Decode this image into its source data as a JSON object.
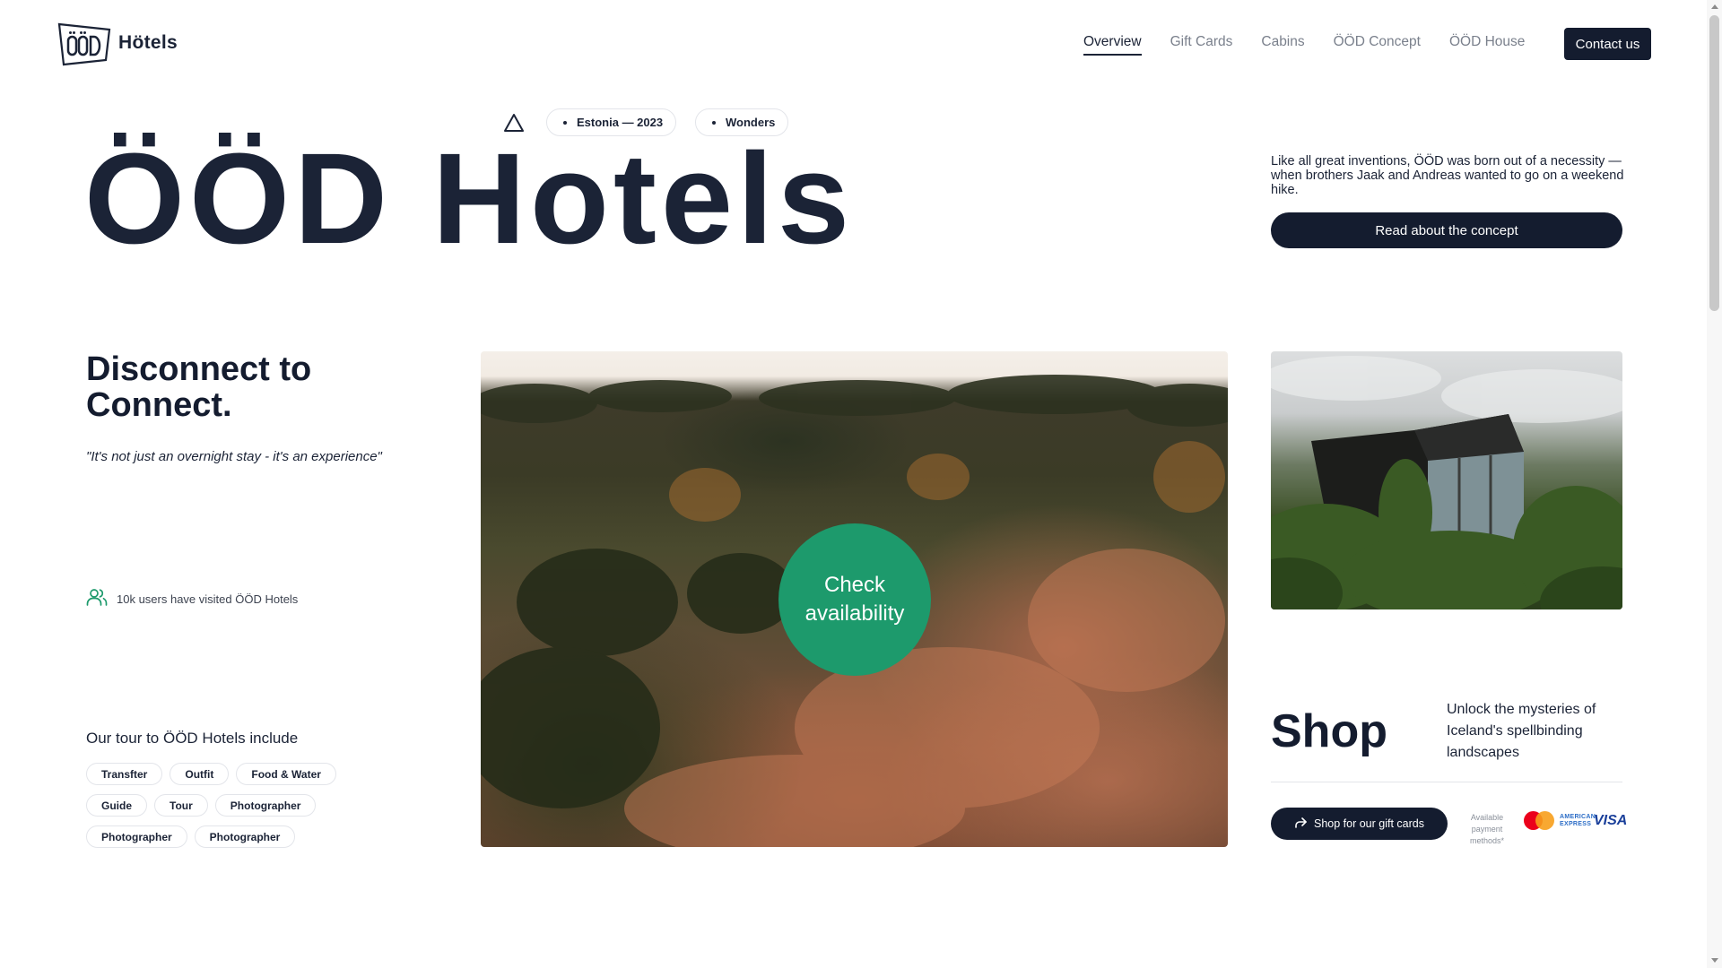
{
  "header": {
    "logo_text": "Hötels",
    "nav": [
      {
        "label": "Overview",
        "active": true
      },
      {
        "label": "Gift Cards",
        "active": false
      },
      {
        "label": "Cabins",
        "active": false
      },
      {
        "label": "ÖÖD Concept",
        "active": false
      },
      {
        "label": "ÖÖD House",
        "active": false
      }
    ],
    "contact_label": "Contact us"
  },
  "hero": {
    "icon": "triangle-icon",
    "tags": [
      "Estonia — 2023",
      "Wonders"
    ],
    "title": "ÖÖD Hotels",
    "description": "Like all great inventions, ÖÖD was born out of a necessity — when brothers Jaak and Andreas wanted to go on a weekend hike.",
    "concept_button": "Read about the concept"
  },
  "intro": {
    "heading": "Disconnect to Connect.",
    "quote": "\"It's not just an overnight stay - it's an experience\"",
    "visitors_text": "10k users have visited ÖÖD Hotels"
  },
  "tour": {
    "title": "Our tour to ÖÖD Hotels include",
    "items": [
      "Transfter",
      "Outfit",
      "Food & Water",
      "Guide",
      "Tour",
      "Photographer",
      "Photographer",
      "Photographer"
    ]
  },
  "main_photo": {
    "check_button": "Check availability"
  },
  "shop": {
    "title": "Shop",
    "description": "Unlock the mysteries of Iceland's spellbinding landscapes",
    "button": "Shop for our gift cards",
    "payment_label": "Available payment methods*",
    "payment_methods": [
      "mastercard-icon",
      "amex-icon",
      "visa-icon"
    ],
    "amex_text": "AMERICAN EXPRESS",
    "visa_text": "VISA"
  },
  "colors": {
    "primary_dark": "#141c2f",
    "accent_green": "#1d9a6c",
    "text": "#1b2336",
    "muted": "#7a808c"
  }
}
